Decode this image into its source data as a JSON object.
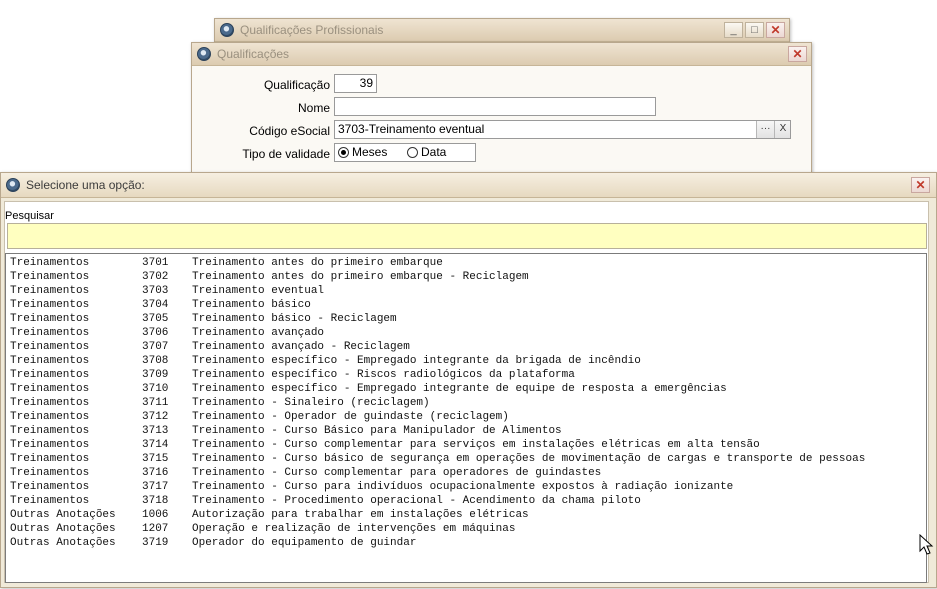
{
  "back_window": {
    "title": "Qualificações Profissionais",
    "minimize_label": "_",
    "maximize_label": "□",
    "close_label": "✕"
  },
  "form_window": {
    "title": "Qualificações",
    "close_label": "✕",
    "fields": {
      "qualificacao": {
        "label": "Qualificação",
        "value": "39"
      },
      "nome": {
        "label": "Nome",
        "value": ""
      },
      "codigo_esocial": {
        "label": "Código eSocial",
        "value": "3703-Treinamento eventual",
        "browse_label": "···",
        "clear_label": "X"
      },
      "tipo_validade": {
        "label": "Tipo de validade",
        "options": [
          "Meses",
          "Data"
        ],
        "selected": "Meses"
      }
    }
  },
  "select_dialog": {
    "title": "Selecione uma opção:",
    "close_label": "✕",
    "search_label": "Pesquisar",
    "search_value": "",
    "search_bg_color": "#ffffc0",
    "rows": [
      {
        "category": "Treinamentos",
        "code": "3701",
        "description": "Treinamento antes do primeiro embarque"
      },
      {
        "category": "Treinamentos",
        "code": "3702",
        "description": "Treinamento antes do primeiro embarque - Reciclagem"
      },
      {
        "category": "Treinamentos",
        "code": "3703",
        "description": "Treinamento eventual"
      },
      {
        "category": "Treinamentos",
        "code": "3704",
        "description": "Treinamento básico"
      },
      {
        "category": "Treinamentos",
        "code": "3705",
        "description": "Treinamento básico - Reciclagem"
      },
      {
        "category": "Treinamentos",
        "code": "3706",
        "description": "Treinamento avançado"
      },
      {
        "category": "Treinamentos",
        "code": "3707",
        "description": "Treinamento avançado - Reciclagem"
      },
      {
        "category": "Treinamentos",
        "code": "3708",
        "description": "Treinamento específico - Empregado integrante da brigada de incêndio"
      },
      {
        "category": "Treinamentos",
        "code": "3709",
        "description": "Treinamento específico - Riscos radiológicos da plataforma"
      },
      {
        "category": "Treinamentos",
        "code": "3710",
        "description": "Treinamento específico - Empregado integrante de equipe de resposta a emergências"
      },
      {
        "category": "Treinamentos",
        "code": "3711",
        "description": "Treinamento - Sinaleiro (reciclagem)"
      },
      {
        "category": "Treinamentos",
        "code": "3712",
        "description": "Treinamento - Operador de guindaste (reciclagem)"
      },
      {
        "category": "Treinamentos",
        "code": "3713",
        "description": "Treinamento - Curso Básico para Manipulador de Alimentos"
      },
      {
        "category": "Treinamentos",
        "code": "3714",
        "description": "Treinamento - Curso complementar para serviços em instalações elétricas em alta tensão"
      },
      {
        "category": "Treinamentos",
        "code": "3715",
        "description": "Treinamento - Curso básico de segurança em operações de movimentação de cargas e transporte de pessoas"
      },
      {
        "category": "Treinamentos",
        "code": "3716",
        "description": "Treinamento - Curso complementar para operadores de guindastes"
      },
      {
        "category": "Treinamentos",
        "code": "3717",
        "description": "Treinamento - Curso para indivíduos ocupacionalmente expostos à radiação ionizante"
      },
      {
        "category": "Treinamentos",
        "code": "3718",
        "description": "Treinamento - Procedimento operacional - Acendimento da chama piloto"
      },
      {
        "category": "Outras Anotações",
        "code": "1006",
        "description": "Autorização para trabalhar em instalações elétricas"
      },
      {
        "category": "Outras Anotações",
        "code": "1207",
        "description": "Operação e realização de intervenções em máquinas"
      },
      {
        "category": "Outras Anotações",
        "code": "3719",
        "description": "Operador do equipamento de guindar"
      }
    ]
  }
}
